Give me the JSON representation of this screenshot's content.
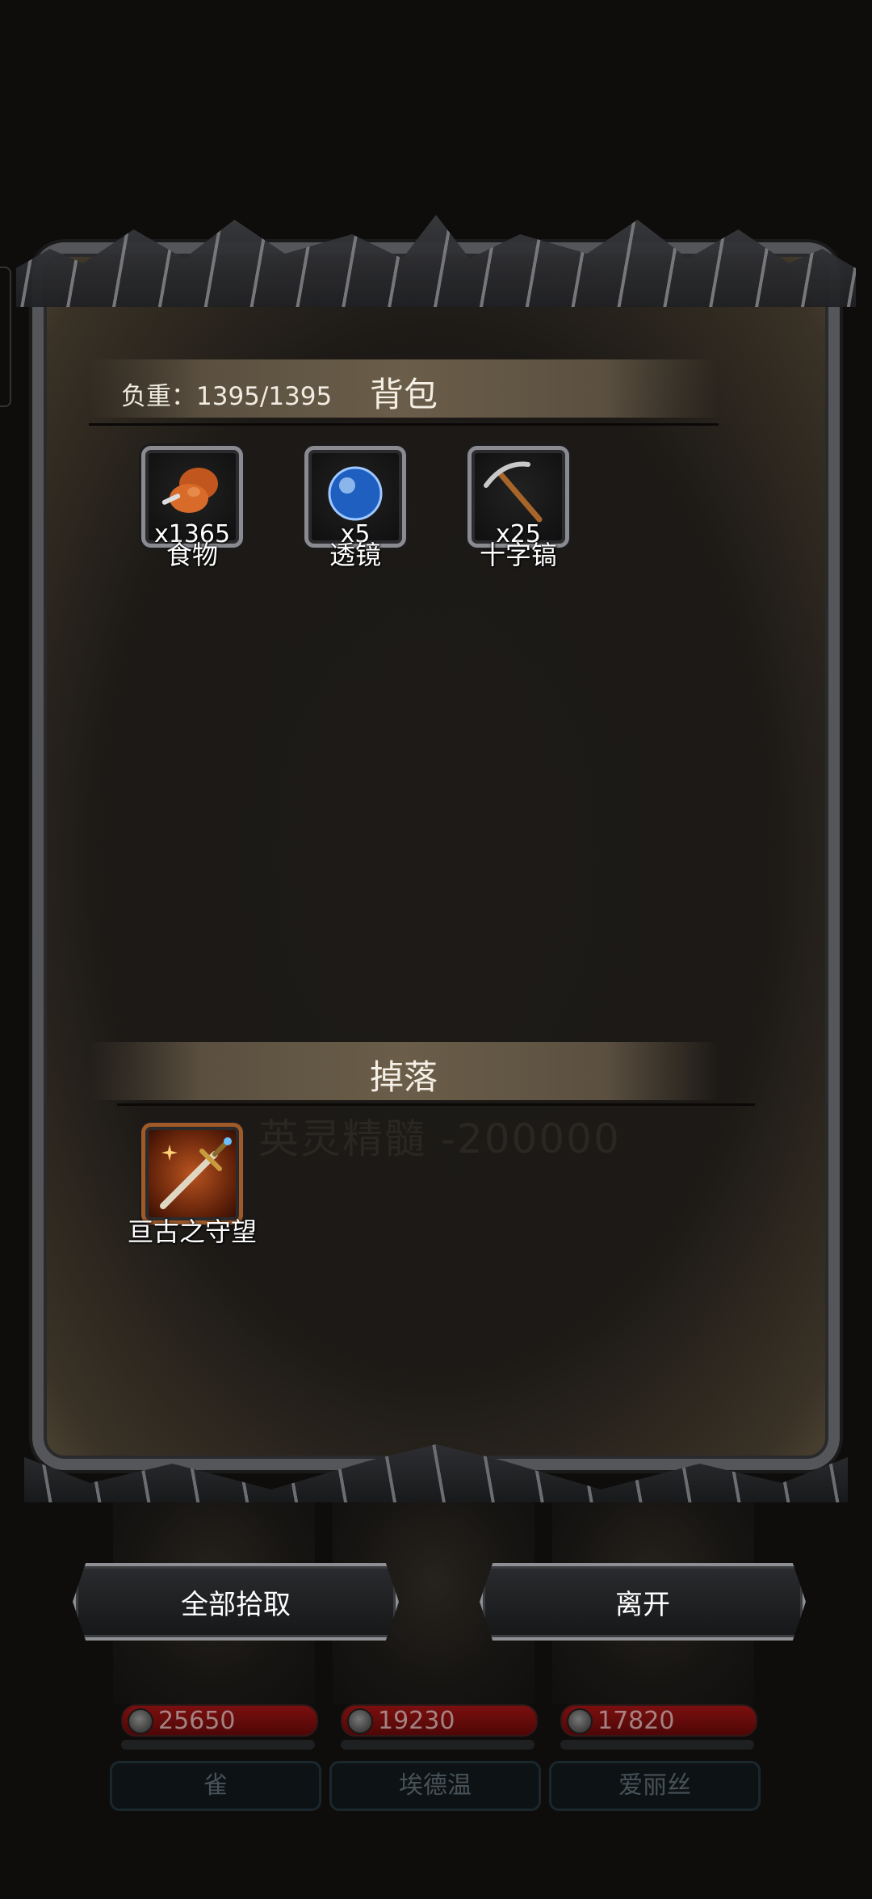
{
  "bag": {
    "title": "背包",
    "weight_text": "负重：1395/1395",
    "items": [
      {
        "icon": "food-icon",
        "qty": "x1365",
        "name": "食物"
      },
      {
        "icon": "lens-orb-icon",
        "qty": "x5",
        "name": "透镜"
      },
      {
        "icon": "pickaxe-icon",
        "qty": "x25",
        "name": "十字镐"
      }
    ]
  },
  "drop": {
    "title": "掉落",
    "items": [
      {
        "icon": "sword-icon",
        "name": "亘古之守望"
      }
    ],
    "faint_text": "英灵精髓 -200000"
  },
  "buttons": {
    "pickup_all": "全部拾取",
    "leave": "离开"
  },
  "heroes": [
    {
      "hp": "25650",
      "name": "雀"
    },
    {
      "hp": "19230",
      "name": "埃德温"
    },
    {
      "hp": "17820",
      "name": "爱丽丝"
    }
  ],
  "colors": {
    "panel_bg": "#1c1916",
    "frame_metal": "#8a8b90",
    "hp_red": "#8e1010"
  }
}
